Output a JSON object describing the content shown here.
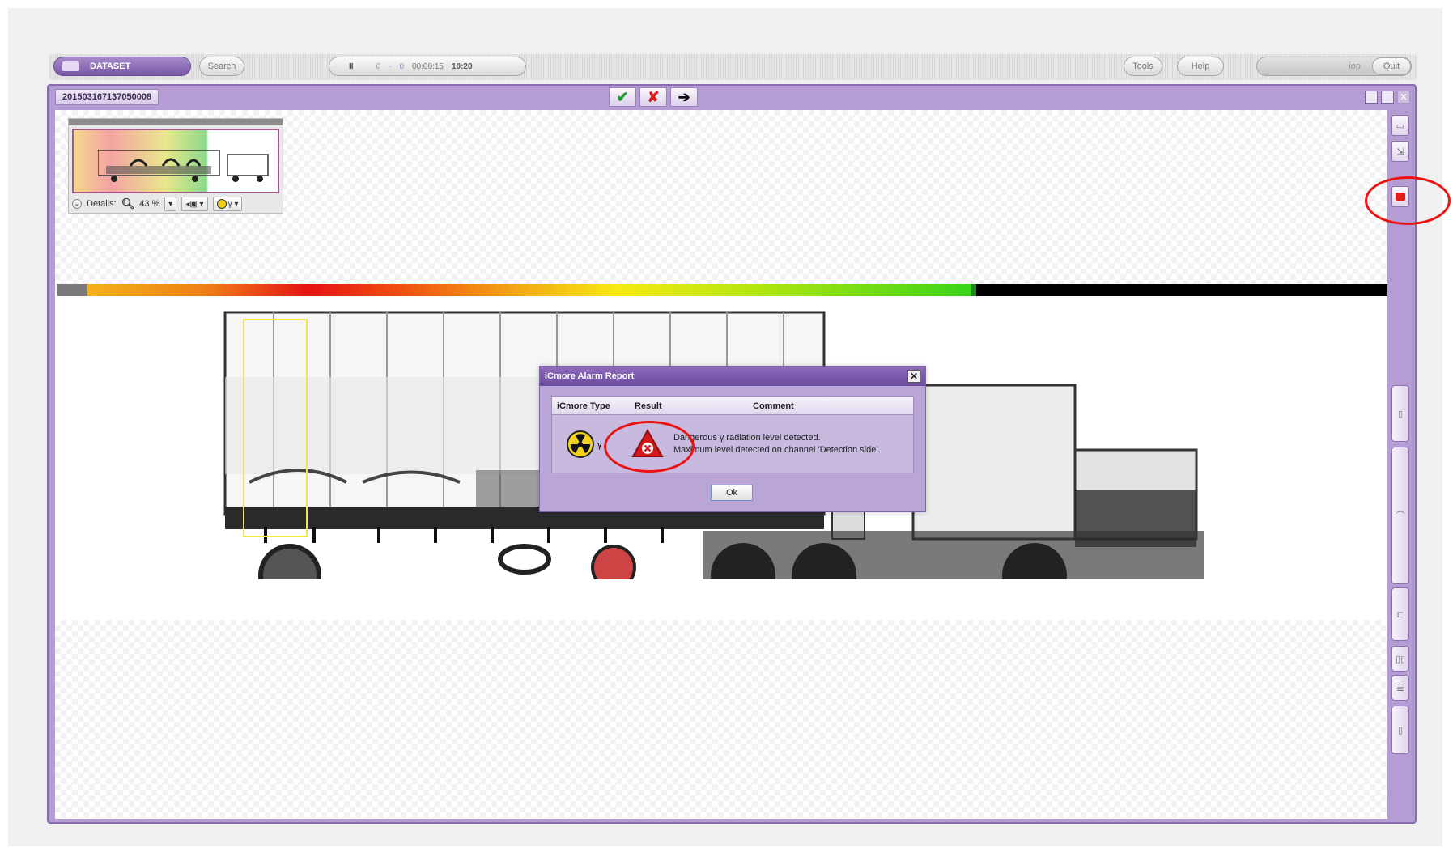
{
  "toolbar": {
    "dataset_label": "DATASET",
    "search_label": "Search",
    "pause_label": "II",
    "counter_from": "0",
    "counter_sep": "-",
    "counter_to": "0",
    "elapsed": "00:00:15",
    "clock": "10:20",
    "tools_label": "Tools",
    "help_label": "Help",
    "user_label": "iop",
    "quit_label": "Quit"
  },
  "window": {
    "title": "201503167137050008",
    "approve_icon": "checkmark-icon",
    "reject_icon": "x-mark-icon",
    "next_icon": "arrow-right-icon"
  },
  "overview": {
    "details_label": "Details:",
    "zoom_value": "43 %",
    "radiation_option": "γ"
  },
  "dialog": {
    "title": "iCmore Alarm Report",
    "close_label": "✕",
    "columns": [
      "iCmore Type",
      "Result",
      "Comment"
    ],
    "type_symbol": "γ",
    "comment_line1": "Dangerous γ radiation level detected.",
    "comment_line2": "Maximum level detected on channel 'Detection side'.",
    "ok_label": "Ok"
  },
  "colors": {
    "window_frame": "#b59cd4",
    "alarm_red": "#e11d1d",
    "annotation_yellow": "#f0e83a"
  }
}
